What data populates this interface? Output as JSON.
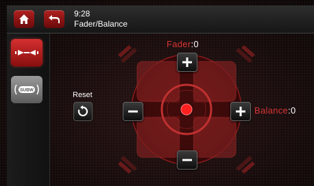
{
  "header": {
    "time": "9:28",
    "title": "Fader/Balance",
    "home_icon": "home-icon",
    "back_icon": "back-arrow-icon"
  },
  "sidebar": {
    "items": [
      {
        "name": "fader-balance",
        "icon": "speaker-balance-icon",
        "selected": true
      },
      {
        "name": "subwoofer",
        "icon": "subw-icon",
        "label": "SUBW",
        "selected": false
      }
    ]
  },
  "reset": {
    "label": "Reset",
    "icon": "reset-icon"
  },
  "fader": {
    "label": "Fader",
    "separator": ":",
    "value": "0"
  },
  "balance": {
    "label": "Balance",
    "separator": ":",
    "value": "0"
  },
  "colors": {
    "accent": "#e02020",
    "background": "#120808",
    "label": "#d83434"
  }
}
